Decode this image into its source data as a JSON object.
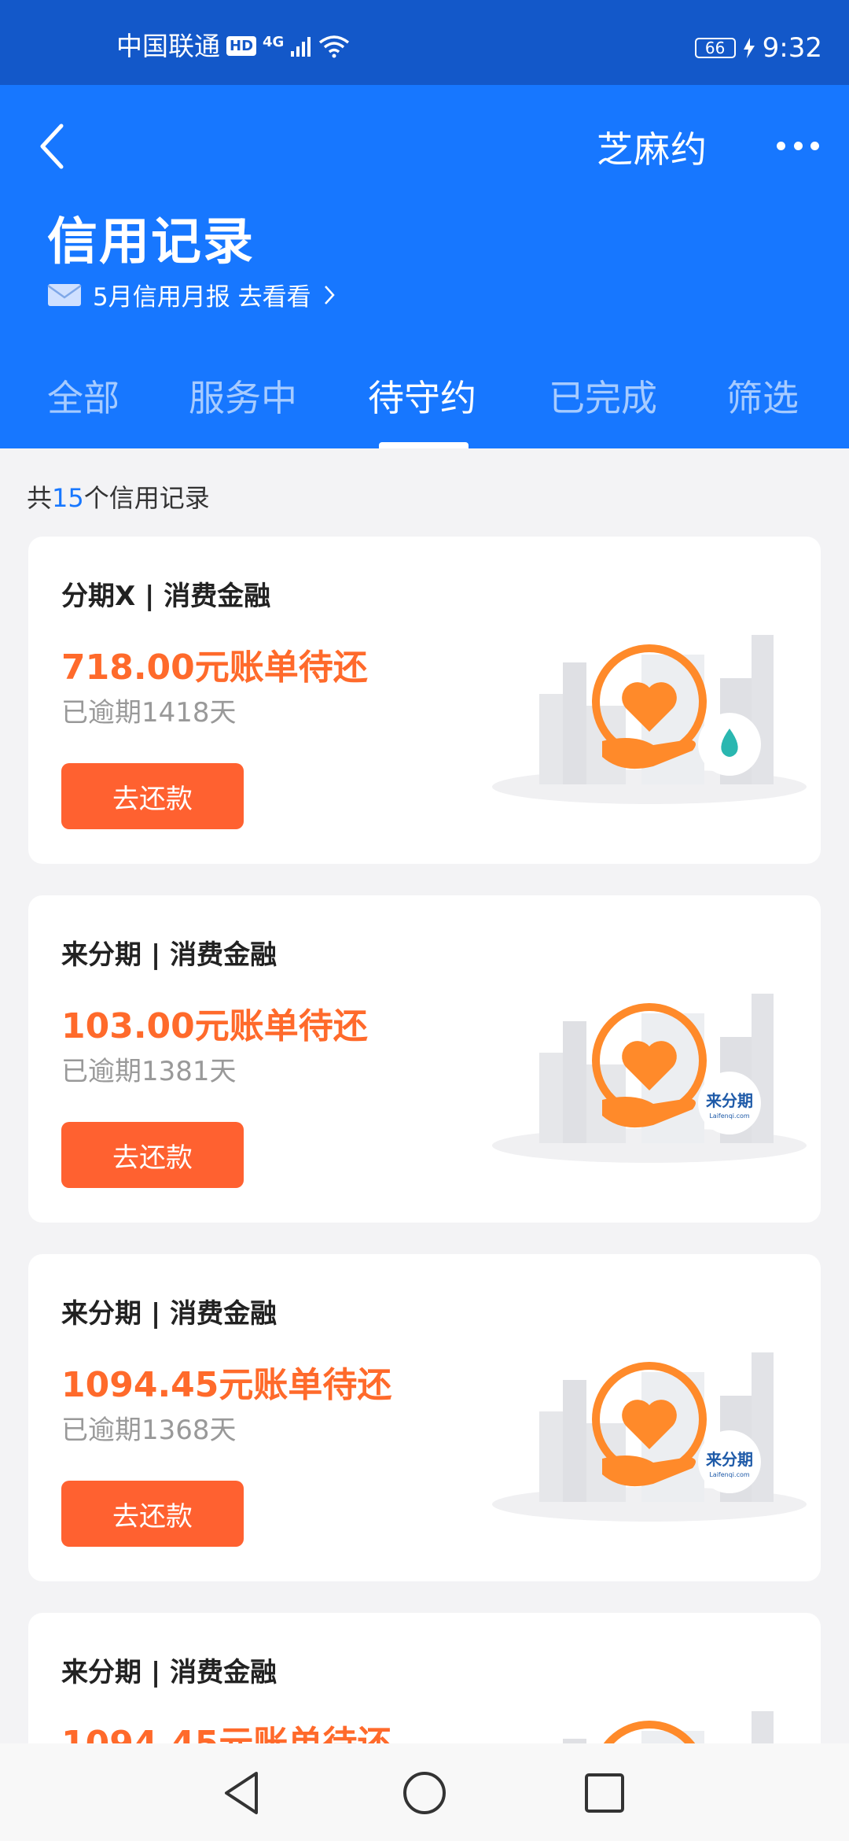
{
  "status_bar": {
    "carrier": "中国联通",
    "hd": "HD",
    "network": "4G",
    "battery": "66",
    "time": "9:32"
  },
  "header": {
    "right_label": "芝麻约",
    "title": "信用记录",
    "report_link": "5月信用月报 去看看"
  },
  "tabs": [
    {
      "label": "全部"
    },
    {
      "label": "服务中"
    },
    {
      "label": "待守约",
      "active": true
    },
    {
      "label": "已完成"
    },
    {
      "label": "筛选"
    }
  ],
  "summary": {
    "prefix": "共",
    "count": "15",
    "suffix": "个信用记录"
  },
  "cards": [
    {
      "title": "分期X | 消费金融",
      "amount": "718.00元账单待还",
      "overdue": "已逾期1418天",
      "button": "去还款",
      "badge_icon": "water-drop-icon"
    },
    {
      "title": "来分期 | 消费金融",
      "amount": "103.00元账单待还",
      "overdue": "已逾期1381天",
      "button": "去还款",
      "badge_text": "来分期",
      "badge_sub": "Laifenqi.com"
    },
    {
      "title": "来分期 | 消费金融",
      "amount": "1094.45元账单待还",
      "overdue": "已逾期1368天",
      "button": "去还款",
      "badge_text": "来分期",
      "badge_sub": "Laifenqi.com"
    },
    {
      "title": "来分期 | 消费金融",
      "amount": "1094.45元账单待还",
      "overdue": "",
      "button": "",
      "badge_text": "",
      "badge_sub": ""
    }
  ],
  "colors": {
    "status_bar": "#1358c9",
    "header": "#1777ff",
    "accent_orange": "#ff6a2b",
    "button_orange": "#ff6130",
    "background": "#f3f3f5"
  }
}
